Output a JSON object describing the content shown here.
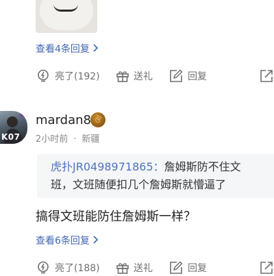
{
  "first_comment": {
    "view_replies": "查看4条回复",
    "actions": {
      "like": "亮了(192)",
      "gift": "送礼",
      "reply": "回复"
    }
  },
  "second_comment": {
    "avatar_text": "K07",
    "username": "mardan8",
    "badge_glyph": "ঔ",
    "time": "2小时前",
    "separator": "·",
    "location": "新疆",
    "quote": {
      "user": "虎扑JR0498971865：",
      "line1": "詹姆斯防不住文",
      "line2": "班，文班随便扣几个詹姆斯就懵逼了"
    },
    "text": "搞得文班能防住詹姆斯一样？",
    "view_replies": "查看6条回复",
    "actions": {
      "like": "亮了(188)",
      "gift": "送礼",
      "reply": "回复"
    }
  },
  "icons": {
    "like": "lightbulb-icon",
    "gift": "gift-icon",
    "reply": "edit-icon",
    "share": "share-icon",
    "more": "chevron-right-icon"
  },
  "colors": {
    "link": "#3f66b4",
    "quote_user": "#4f73bf",
    "action_text": "#6f6f6f",
    "quote_bg": "#f5f6f8"
  }
}
